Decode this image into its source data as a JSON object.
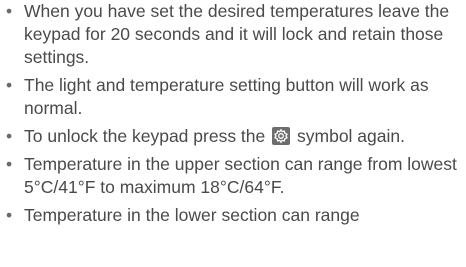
{
  "list": {
    "items": [
      {
        "text": "When you have set the desired temperatures leave the keypad for 20 seconds and it will lock and retain those settings."
      },
      {
        "text": "The light and temperature setting button will work as normal."
      },
      {
        "text_before": "To unlock the keypad press the",
        "icon": "settings-icon",
        "text_after": "symbol again."
      },
      {
        "text": "Temperature in the upper section can range from lowest 5°C/41°F to maximum 18°C/64°F."
      },
      {
        "text": "Temperature in the lower section can range"
      }
    ]
  }
}
